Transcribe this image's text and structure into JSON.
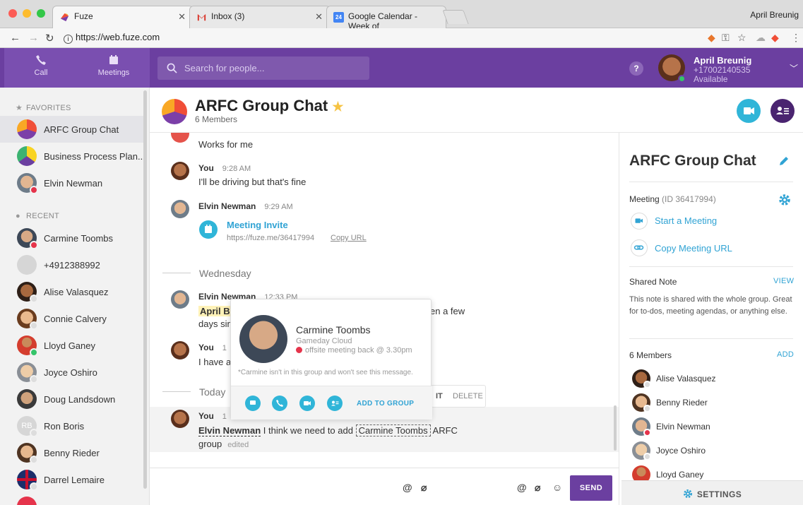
{
  "browser": {
    "tabs": [
      {
        "label": "Fuze",
        "active": true
      },
      {
        "label": "Inbox (3)",
        "active": false
      },
      {
        "label": "Google Calendar - Week of",
        "active": false
      }
    ],
    "calendar_badge": "24",
    "user": "April Breunig",
    "url": "https://web.fuze.com"
  },
  "nav": {
    "call_label": "Call",
    "meetings_label": "Meetings",
    "search_placeholder": "Search for people...",
    "help_label": "?"
  },
  "me": {
    "name": "April Breunig",
    "phone": "+17002140535",
    "status": "Available"
  },
  "sidebar": {
    "favorites_label": "FAVORITES",
    "recent_label": "RECENT",
    "favorites": [
      {
        "name": "ARFC Group Chat"
      },
      {
        "name": "Business Process Plan..."
      },
      {
        "name": "Elvin Newman"
      }
    ],
    "recent": [
      {
        "name": "Carmine Toombs"
      },
      {
        "name": "+4912388992"
      },
      {
        "name": "Alise Valasquez"
      },
      {
        "name": "Connie Calvery"
      },
      {
        "name": "Lloyd Ganey"
      },
      {
        "name": "Joyce Oshiro"
      },
      {
        "name": "Doug Landsdown"
      },
      {
        "name": "Ron Boris",
        "initials": "RB"
      },
      {
        "name": "Benny Rieder"
      },
      {
        "name": "Darrel Lemaire"
      }
    ]
  },
  "chat": {
    "title": "ARFC Group Chat",
    "members_count": "6 Members",
    "messages": {
      "m1_text": "Works for me",
      "m2_author": "You",
      "m2_time": "9:28 AM",
      "m2_text": "I'll be driving but that's fine",
      "m3_author": "Elvin Newman",
      "m3_time": "9:29 AM",
      "invite_title": "Meeting Invite",
      "invite_url": "https://fuze.me/36417994",
      "copy_url": "Copy URL",
      "day_wed": "Wednesday",
      "m4_author": "Elvin Newman",
      "m4_time": "12:33 PM",
      "m4_mention": "April Br",
      "m4_text_end": "en a few",
      "m4_line2": "days sin",
      "m5_author": "You",
      "m5_time": "1",
      "m5_text": "I have a",
      "day_today": "Today",
      "m6_author": "You",
      "m6_time": "1",
      "m6_mention": "Elvin Newman",
      "m6_mid": "I think we need to add",
      "m6_token": "Carmine Toombs",
      "m6_end": "ARFC",
      "m6_line2": "group",
      "m6_edited": "edited"
    },
    "actions": {
      "edit": "IT",
      "delete": "DELETE"
    },
    "composer": {
      "send_label": "SEND",
      "at": "@"
    }
  },
  "card": {
    "name": "Carmine Toombs",
    "company": "Gameday Cloud",
    "status": "offsite meeting back @ 3.30pm",
    "note": "*Carmine isn't in this group and won't see this message.",
    "add_to_group": "ADD TO GROUP"
  },
  "panel": {
    "title": "ARFC Group Chat",
    "meeting_label": "Meeting",
    "meeting_id": "(ID 36417994)",
    "start_meeting": "Start a Meeting",
    "copy_meeting_url": "Copy Meeting URL",
    "shared_note_label": "Shared Note",
    "view_label": "VIEW",
    "shared_note_text": "This note is shared with the whole group. Great for to-dos, meeting agendas, or anything else.",
    "members_label": "6 Members",
    "add_label": "ADD",
    "members": [
      {
        "name": "Alise Valasquez"
      },
      {
        "name": "Benny Rieder"
      },
      {
        "name": "Elvin Newman"
      },
      {
        "name": "Joyce Oshiro"
      },
      {
        "name": "Lloyd Ganey"
      }
    ],
    "settings_label": "SETTINGS"
  },
  "colors": {
    "brand_purple": "#6b3fa0",
    "accent_blue": "#30b5d8",
    "dnd_red": "#e5344b",
    "available_green": "#35c46a",
    "favorite_star": "#f6c343"
  }
}
